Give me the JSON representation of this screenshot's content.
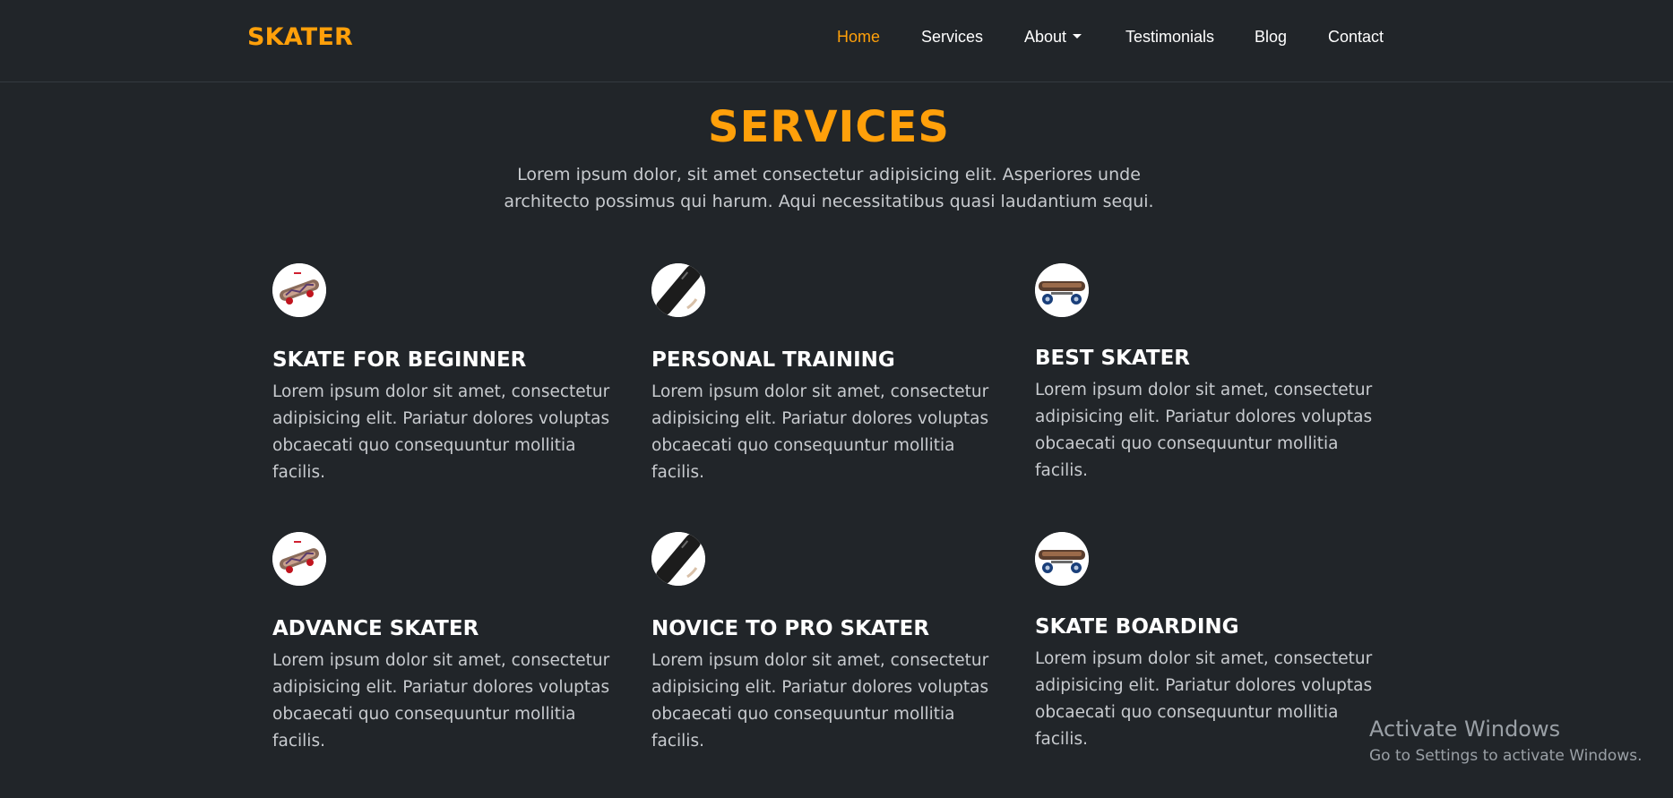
{
  "brand": "SKATER",
  "nav": {
    "items": [
      {
        "label": "Home"
      },
      {
        "label": "Services"
      },
      {
        "label": "About"
      },
      {
        "label": "Testimonials"
      },
      {
        "label": "Blog"
      },
      {
        "label": "Contact"
      }
    ]
  },
  "colors": {
    "accent": "#ffa00a",
    "background": "#212529",
    "text_muted": "#c8cbcf"
  },
  "section": {
    "title": "SERVICES",
    "lead": "Lorem ipsum dolor, sit amet consectetur adipisicing elit. Asperiores unde architecto possimus qui harum. Aqui necessitatibus quasi laudantium sequi."
  },
  "services": [
    {
      "icon": "skateboard-red-wheels-icon",
      "title": "SKATE FOR BEGINNER",
      "text": "Lorem ipsum dolor sit amet, consectetur adipisicing elit. Pariatur dolores voluptas obcaecati quo consequuntur mollitia facilis."
    },
    {
      "icon": "skateboard-deck-icon",
      "title": "PERSONAL TRAINING",
      "text": "Lorem ipsum dolor sit amet, consectetur adipisicing elit. Pariatur dolores voluptas obcaecati quo consequuntur mollitia facilis."
    },
    {
      "icon": "skateboard-blue-wheels-icon",
      "title": "BEST SKATER",
      "text": "Lorem ipsum dolor sit amet, consectetur adipisicing elit. Pariatur dolores voluptas obcaecati quo consequuntur mollitia facilis."
    },
    {
      "icon": "skateboard-red-wheels-icon",
      "title": "ADVANCE SKATER",
      "text": "Lorem ipsum dolor sit amet, consectetur adipisicing elit. Pariatur dolores voluptas obcaecati quo consequuntur mollitia facilis."
    },
    {
      "icon": "skateboard-deck-icon",
      "title": "NOVICE TO PRO SKATER",
      "text": "Lorem ipsum dolor sit amet, consectetur adipisicing elit. Pariatur dolores voluptas obcaecati quo consequuntur mollitia facilis."
    },
    {
      "icon": "skateboard-blue-wheels-icon",
      "title": "SKATE BOARDING",
      "text": "Lorem ipsum dolor sit amet, consectetur adipisicing elit. Pariatur dolores voluptas obcaecati quo consequuntur mollitia facilis."
    }
  ],
  "watermark": {
    "title": "Activate Windows",
    "subtitle": "Go to Settings to activate Windows."
  }
}
